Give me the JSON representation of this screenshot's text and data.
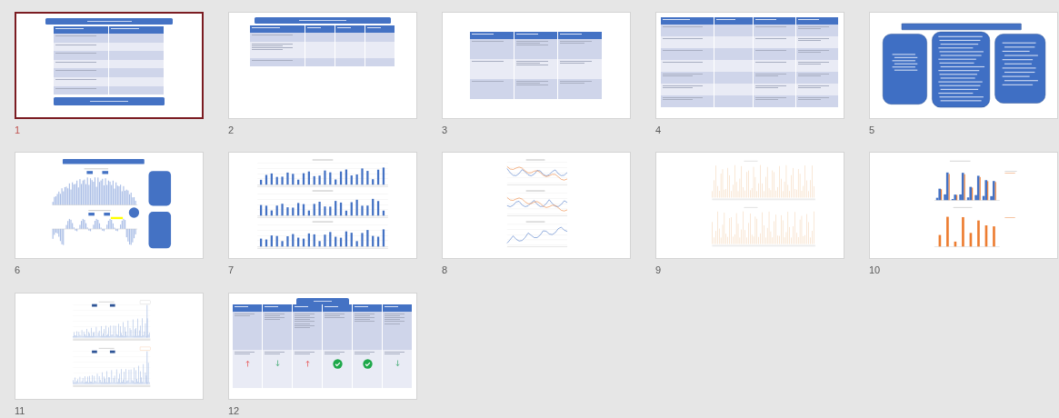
{
  "slides": [
    {
      "number": "1",
      "selected": true,
      "kind": "overview-table"
    },
    {
      "number": "2",
      "selected": false,
      "kind": "comparison-table"
    },
    {
      "number": "3",
      "selected": false,
      "kind": "factor-table"
    },
    {
      "number": "4",
      "selected": false,
      "kind": "metrics-table"
    },
    {
      "number": "5",
      "selected": false,
      "kind": "diagram"
    },
    {
      "number": "6",
      "selected": false,
      "kind": "titled-charts",
      "panels": [
        {
          "kind": "histogram"
        },
        {
          "kind": "diverging"
        }
      ]
    },
    {
      "number": "7",
      "selected": false,
      "kind": "charts",
      "panels": [
        {
          "kind": "bars"
        },
        {
          "kind": "bars"
        },
        {
          "kind": "bars"
        }
      ]
    },
    {
      "number": "8",
      "selected": false,
      "kind": "charts",
      "panels": [
        {
          "kind": "lines"
        },
        {
          "kind": "lines"
        },
        {
          "kind": "lines"
        }
      ]
    },
    {
      "number": "9",
      "selected": false,
      "kind": "charts",
      "panels": [
        {
          "kind": "faint-spikes"
        },
        {
          "kind": "faint-spikes"
        }
      ]
    },
    {
      "number": "10",
      "selected": false,
      "kind": "charts",
      "panels": [
        {
          "kind": "clustered-bars"
        },
        {
          "kind": "orange-bars"
        }
      ]
    },
    {
      "number": "11",
      "selected": false,
      "kind": "charts",
      "panels": [
        {
          "kind": "blue-spikes"
        },
        {
          "kind": "blue-spikes"
        }
      ]
    },
    {
      "number": "12",
      "selected": false,
      "kind": "summary-table",
      "indicators": [
        {
          "kind": "up-arrow"
        },
        {
          "kind": "down-arrow"
        },
        {
          "kind": "up-arrow"
        },
        {
          "kind": "check"
        },
        {
          "kind": "check"
        },
        {
          "kind": "down-arrow"
        }
      ]
    }
  ]
}
